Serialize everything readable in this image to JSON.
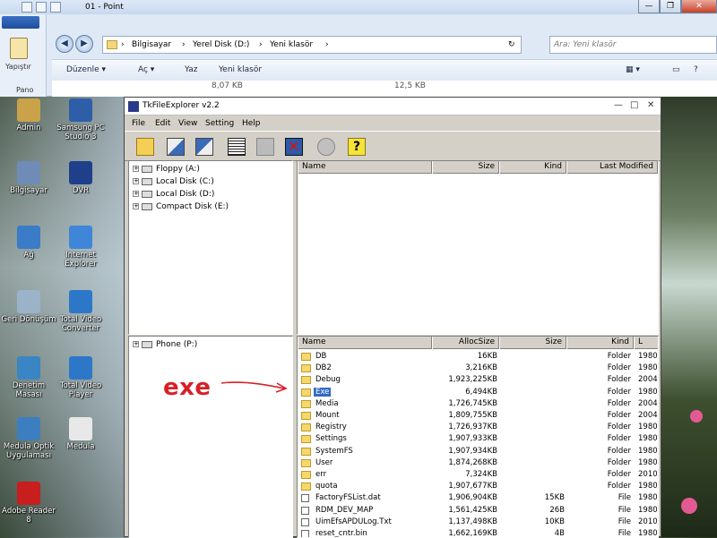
{
  "top_window": {
    "title": "01 - Point",
    "paste_label": "Yapıştır",
    "group_label": "Pano",
    "breadcrumb": [
      "Bilgisayar",
      "Yerel Disk (D:)",
      "Yeni klasör"
    ],
    "search_placeholder": "Ara: Yeni klasör",
    "commands": [
      "Düzenle ▾",
      "Aç ▾",
      "Yaz",
      "Yeni klasör"
    ],
    "list_fragments": [
      "8,07 KB",
      "12,5 KB"
    ],
    "window_buttons": [
      "—",
      "❐",
      "✕"
    ]
  },
  "desktop_icons": [
    {
      "label": "Admin",
      "color": "#c9a24a"
    },
    {
      "label": "Samsung PC Studio 3",
      "color": "#2f5ea8"
    },
    {
      "label": "Bilgisayar",
      "color": "#6e8cb5"
    },
    {
      "label": "DVR",
      "color": "#1f3f8a"
    },
    {
      "label": "Ağ",
      "color": "#3a7cc7"
    },
    {
      "label": "Internet Explorer",
      "color": "#3f86d8"
    },
    {
      "label": "Geri Dönüşüm",
      "color": "#9bb3c8"
    },
    {
      "label": "Total Video Converter",
      "color": "#2d77c9"
    },
    {
      "label": "Denetim Masası",
      "color": "#3a85c4"
    },
    {
      "label": "Total Video Player",
      "color": "#2d77c9"
    },
    {
      "label": "Medula Optik Uygulaması",
      "color": "#3b7fc0"
    },
    {
      "label": "Medula",
      "color": "#e8e8e8"
    },
    {
      "label": "Adobe Reader 8",
      "color": "#c81e1e"
    }
  ],
  "tk": {
    "title": "TkFileExplorer v2.2",
    "window_buttons": [
      "—",
      "□",
      "✕"
    ],
    "menu": [
      "File",
      "Edit",
      "View",
      "Setting",
      "Help"
    ],
    "toolbar_icons": [
      "open-folder-icon",
      "copy-to-pc-icon",
      "copy-to-phone-icon",
      "list-view-icon",
      "move-icon",
      "delete-icon",
      "settings-icon",
      "help-icon"
    ],
    "pc_tree": [
      {
        "label": "Floppy (A:)"
      },
      {
        "label": "Local Disk (C:)"
      },
      {
        "label": "Local Disk (D:)"
      },
      {
        "label": "Compact Disk (E:)"
      }
    ],
    "pc_columns": [
      "Name",
      "Size",
      "Kind",
      "Last Modified"
    ],
    "phone_tree": [
      {
        "label": "Phone (P:)"
      }
    ],
    "phone_columns": [
      "Name",
      "AllocSize",
      "Size",
      "Kind",
      "L"
    ],
    "phone_rows": [
      {
        "name": "DB",
        "alloc": "16KB",
        "size": "",
        "kind": "Folder",
        "date": "1980",
        "type": "folder"
      },
      {
        "name": "DB2",
        "alloc": "3,216KB",
        "size": "",
        "kind": "Folder",
        "date": "1980",
        "type": "folder"
      },
      {
        "name": "Debug",
        "alloc": "1,923,225KB",
        "size": "",
        "kind": "Folder",
        "date": "2004",
        "type": "folder"
      },
      {
        "name": "Exe",
        "alloc": "6,494KB",
        "size": "",
        "kind": "Folder",
        "date": "1980",
        "type": "folder",
        "selected": true
      },
      {
        "name": "Media",
        "alloc": "1,726,745KB",
        "size": "",
        "kind": "Folder",
        "date": "2004",
        "type": "folder"
      },
      {
        "name": "Mount",
        "alloc": "1,809,755KB",
        "size": "",
        "kind": "Folder",
        "date": "2004",
        "type": "folder"
      },
      {
        "name": "Registry",
        "alloc": "1,726,937KB",
        "size": "",
        "kind": "Folder",
        "date": "1980",
        "type": "folder"
      },
      {
        "name": "Settings",
        "alloc": "1,907,933KB",
        "size": "",
        "kind": "Folder",
        "date": "1980",
        "type": "folder"
      },
      {
        "name": "SystemFS",
        "alloc": "1,907,934KB",
        "size": "",
        "kind": "Folder",
        "date": "1980",
        "type": "folder"
      },
      {
        "name": "User",
        "alloc": "1,874,268KB",
        "size": "",
        "kind": "Folder",
        "date": "1980",
        "type": "folder"
      },
      {
        "name": "err",
        "alloc": "7,324KB",
        "size": "",
        "kind": "Folder",
        "date": "2010",
        "type": "folder"
      },
      {
        "name": "quota",
        "alloc": "1,907,677KB",
        "size": "",
        "kind": "Folder",
        "date": "1980",
        "type": "folder"
      },
      {
        "name": "FactoryFSList.dat",
        "alloc": "1,906,904KB",
        "size": "15KB",
        "kind": "File",
        "date": "1980",
        "type": "file"
      },
      {
        "name": "RDM_DEV_MAP",
        "alloc": "1,561,425KB",
        "size": "26B",
        "kind": "File",
        "date": "1980",
        "type": "file"
      },
      {
        "name": "UimEfsAPDULog.Txt",
        "alloc": "1,137,498KB",
        "size": "10KB",
        "kind": "File",
        "date": "2010",
        "type": "file"
      },
      {
        "name": "reset_cntr.bin",
        "alloc": "1,662,169KB",
        "size": "4B",
        "kind": "File",
        "date": "1980",
        "type": "file"
      }
    ]
  },
  "annotation": {
    "text": "exe",
    "color": "#d81f26"
  }
}
